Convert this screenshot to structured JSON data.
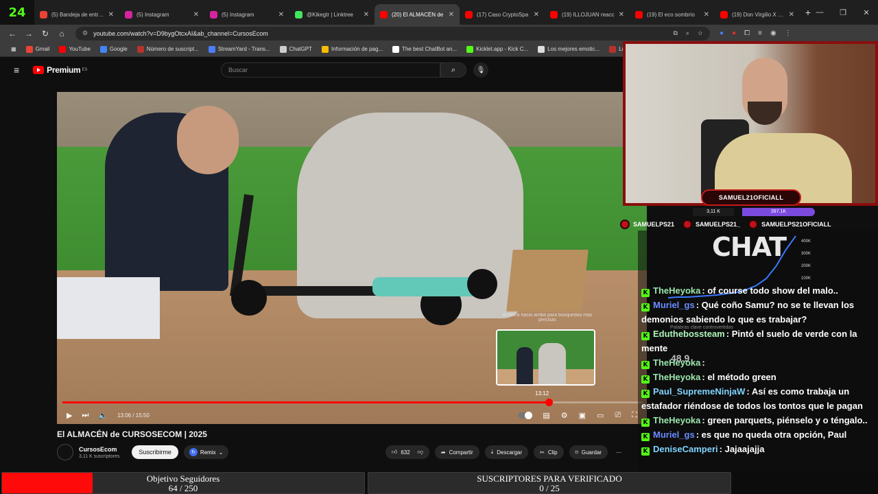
{
  "browser": {
    "logo_text": "24",
    "tabs": [
      {
        "label": "(5) Bandeja de entrada",
        "icon": "gmail-icon",
        "color": "#ea4335",
        "active": false
      },
      {
        "label": "(5) Instagram",
        "icon": "instagram-icon",
        "color": "#d6249f",
        "active": false
      },
      {
        "label": "(5) Instagram",
        "icon": "instagram-icon",
        "color": "#d6249f",
        "active": false
      },
      {
        "label": "@Kikegtr | Linktree",
        "icon": "linktree-icon",
        "color": "#43e55e",
        "active": false
      },
      {
        "label": "(20) El ALMACÉN de",
        "icon": "youtube-icon",
        "color": "#ff0000",
        "active": true
      },
      {
        "label": "(17) Caso CryptoSpa",
        "icon": "youtube-icon",
        "color": "#ff0000",
        "active": false
      },
      {
        "label": "(19) ILLOJUAN reacc",
        "icon": "youtube-icon",
        "color": "#ff0000",
        "active": false
      },
      {
        "label": "(19) El eco sombrío",
        "icon": "youtube-icon",
        "color": "#ff0000",
        "active": false
      },
      {
        "label": "(19) Don Virgilio X Ca",
        "icon": "youtube-icon",
        "color": "#ff0000",
        "active": false
      }
    ],
    "new_tab": "+",
    "url": "youtube.com/watch?v=D9bygOtcxAI&ab_channel=CursosEcom",
    "bookmarks": [
      {
        "label": "Gmail",
        "icon": "gmail-icon",
        "color": "#ea4335"
      },
      {
        "label": "YouTube",
        "icon": "youtube-icon",
        "color": "#ff0000"
      },
      {
        "label": "Google",
        "icon": "google-icon",
        "color": "#4285f4"
      },
      {
        "label": "Número de suscript...",
        "icon": "socialblade-icon",
        "color": "#b5332e"
      },
      {
        "label": "StreamYard - Trans...",
        "icon": "streamyard-icon",
        "color": "#4c7ef7"
      },
      {
        "label": "ChatGPT",
        "icon": "chatgpt-icon",
        "color": "#cccccc"
      },
      {
        "label": "Información de pag...",
        "icon": "drive-icon",
        "color": "#fbbc04"
      },
      {
        "label": "The best ChatBot an...",
        "icon": "bot-icon",
        "color": "#ffffff"
      },
      {
        "label": "Kicklet.app - Kick C...",
        "icon": "kicklet-icon",
        "color": "#53fc18"
      },
      {
        "label": "Los mejores emotic...",
        "icon": "emoticon-icon",
        "color": "#dddddd"
      },
      {
        "label": "Luis F",
        "icon": "folder-icon",
        "color": "#b5332e"
      }
    ]
  },
  "youtube": {
    "logo_text": "Premium",
    "logo_sup": "ES",
    "search_placeholder": "Buscar",
    "player": {
      "hint": "Arrastra hacia arriba para búsquedas más precisas",
      "thumb_time": "13:12",
      "time_display": "13:06 / 15:50",
      "progress": 0.838,
      "hover_progress": 0.833
    },
    "video_title": "El ALMACÉN de CURSOSECOM | 2025",
    "channel_name": "CursosEcom",
    "channel_subs": "3,11 K suscriptores",
    "subscribe": "Suscribirme",
    "remix": "Remix",
    "likes": "632",
    "share": "Compartir",
    "download": "Descargar",
    "clip": "Clip",
    "save": "Guardar"
  },
  "stream": {
    "streamer_name": "SAMUEL21OFICIALL",
    "stat_left": "3,11 K",
    "stat_right": "397.1K",
    "socials": [
      "SAMUELPS21",
      "SAMUELPS21_",
      "SAMUELPS21OFICIALL"
    ],
    "chat_title": "CHAT",
    "graph_ticks": [
      "400K",
      "300K",
      "200K",
      "100K"
    ],
    "graph_points": [
      2,
      3,
      3,
      4,
      5,
      6,
      8,
      10,
      14,
      20,
      30,
      48,
      72,
      92
    ],
    "keyword_note": "Palabras clave controvertidas",
    "big_number": "48.9",
    "messages": [
      {
        "user": "TheHeyoka",
        "text": ": of course todo show del malo..",
        "color": "c1"
      },
      {
        "user": "Muriel_gs",
        "text": ": Qué coño Samu? no se te llevan los demonios sabiendo lo que es trabajar?",
        "color": "c2"
      },
      {
        "user": "Eduthebossteam",
        "text": ": Pintó el suelo de verde con la mente",
        "color": "c3"
      },
      {
        "user": "TheHeyoka",
        "text": ":",
        "color": "c1"
      },
      {
        "user": "TheHeyoka",
        "text": ": el método green",
        "color": "c1"
      },
      {
        "user": "Paul_SupremeNinjaW",
        "text": ": Así es como trabaja un estafador riéndose de todos los tontos que le pagan",
        "color": "c4"
      },
      {
        "user": "TheHeyoka",
        "text": ": green parquets, piénselo y o téngalo..",
        "color": "c1"
      },
      {
        "user": "Muriel_gs",
        "text": ": es que no queda otra opción, Paul",
        "color": "c2"
      },
      {
        "user": "DeniseCamperi",
        "text": ": Jajaajajja",
        "color": "c4"
      }
    ],
    "goals": [
      {
        "title": "Objetivo Seguidores",
        "value": "64 / 250",
        "current": 64,
        "target": 250
      },
      {
        "title": "SUSCRIPTORES PARA VERIFICADO",
        "value": "0 / 25",
        "current": 0,
        "target": 25
      }
    ]
  }
}
